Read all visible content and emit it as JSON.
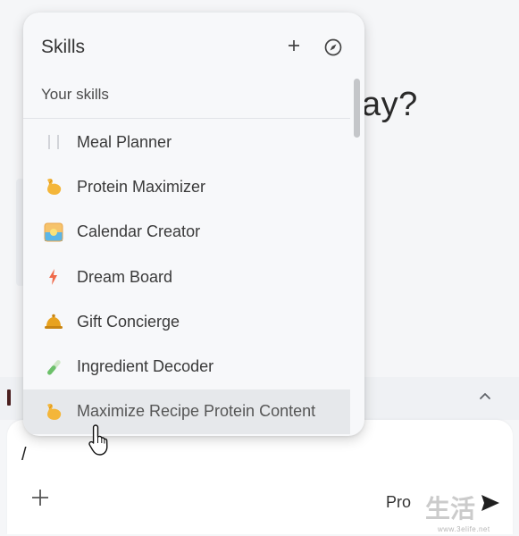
{
  "popup": {
    "title": "Skills",
    "add_icon": "plus-icon",
    "explore_icon": "compass-icon",
    "section_label": "Your skills",
    "items": [
      {
        "label": "Meal Planner",
        "icon": "fork-knife-icon"
      },
      {
        "label": "Protein Maximizer",
        "icon": "flexed-biceps-icon"
      },
      {
        "label": "Calendar Creator",
        "icon": "sunrise-icon"
      },
      {
        "label": "Dream Board",
        "icon": "lightning-icon"
      },
      {
        "label": "Gift Concierge",
        "icon": "bell-icon"
      },
      {
        "label": "Ingredient Decoder",
        "icon": "test-tube-icon"
      },
      {
        "label": "Maximize Recipe Protein Content",
        "icon": "flexed-biceps-icon",
        "hovered": true
      }
    ]
  },
  "background": {
    "greeting_fragment": "ay?"
  },
  "composer": {
    "input_value": "/",
    "model_label": "Pro",
    "add_icon": "plus-icon",
    "send_icon": "send-icon"
  },
  "watermark": {
    "text": "生活",
    "url": "www.3elife.net"
  },
  "colors": {
    "popup_bg": "#f7f8fa",
    "hover_bg": "#e6e8eb",
    "page_bg": "#f5f6f8"
  }
}
